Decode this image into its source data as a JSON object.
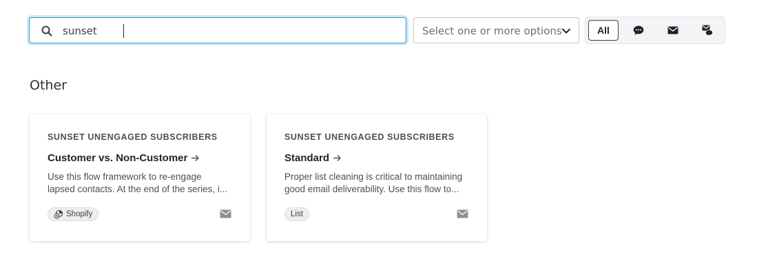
{
  "filters": {
    "search": {
      "value": "sunset",
      "icon": "search-icon"
    },
    "select": {
      "placeholder": "Select one or more options",
      "icon": "chevron-down-icon"
    },
    "channels": [
      {
        "label": "All",
        "active": true
      },
      {
        "icon": "sms-icon",
        "active": false
      },
      {
        "icon": "email-icon",
        "active": false
      },
      {
        "icon": "multichannel-icon",
        "active": false
      }
    ]
  },
  "section": {
    "title": "Other"
  },
  "cards": [
    {
      "category": "SUNSET UNENGAGED SUBSCRIBERS",
      "title": "Customer vs. Non-Customer",
      "description_line1": "Use this flow framework to re-engage",
      "description_line2": "lapsed contacts. At the end of the series, i...",
      "tag": "Shopify",
      "tag_icon": "shopify-icon",
      "channel_icon": "email-icon"
    },
    {
      "category": "SUNSET UNENGAGED SUBSCRIBERS",
      "title": "Standard",
      "description_line1": "Proper list cleaning is critical to maintaining",
      "description_line2": "good email deliverability. Use this flow to...",
      "tag": "List",
      "channel_icon": "email-icon"
    }
  ],
  "colors": {
    "focus_border": "#2f9ad6",
    "text_primary": "#1f2328",
    "text_secondary": "#4a5057",
    "icon_gray": "#8a9097"
  }
}
